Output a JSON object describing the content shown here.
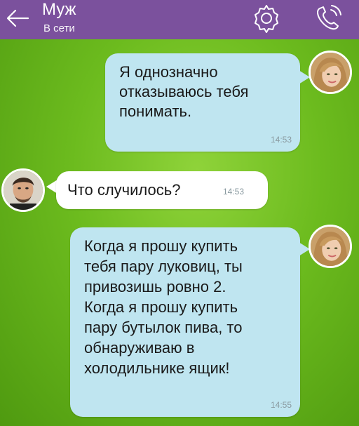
{
  "header": {
    "title": "Муж",
    "status": "В сети",
    "icons": [
      "back-arrow-icon",
      "gear-icon",
      "phone-icon"
    ],
    "bg_color": "#7b519d"
  },
  "messages": [
    {
      "direction": "outgoing",
      "text": "Я однозначно\nотказываюсь тебя\nпонимать.",
      "time": "14:53"
    },
    {
      "direction": "incoming",
      "text": "Что случилось?",
      "time": "14:53"
    },
    {
      "direction": "outgoing",
      "text": "Когда я прошу купить\nтебя пару луковиц, ты\nпривозишь ровно 2.\nКогда я прошу купить\nпару бутылок пива, то\nобнаруживаю в\nхолодильнике ящик!",
      "time": "14:55"
    }
  ],
  "colors": {
    "outgoing_bubble": "#bfe5f0",
    "incoming_bubble": "#ffffff",
    "background": "#6cbb1e"
  }
}
